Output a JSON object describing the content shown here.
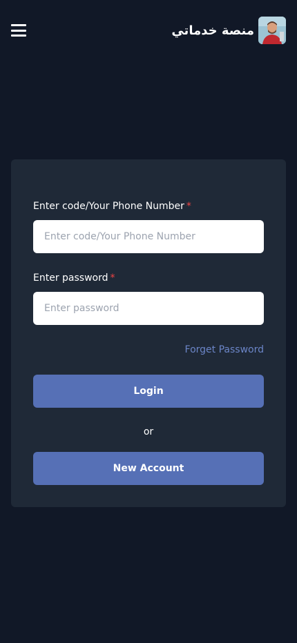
{
  "header": {
    "brand_name": "منصة خدماتي",
    "avatar_icon": "user-avatar-photo",
    "menu_icon": "hamburger-menu-icon"
  },
  "form": {
    "phone_label": "Enter code/Your Phone Number",
    "phone_placeholder": "Enter code/Your Phone Number",
    "phone_value": "",
    "password_label": "Enter password",
    "password_placeholder": "Enter password",
    "password_value": "",
    "required_mark": "*",
    "forget_password": "Forget Password",
    "login_label": "Login",
    "or_text": "or",
    "new_account_label": "New Account"
  },
  "colors": {
    "page_bg": "#111827",
    "card_bg": "#1f2937",
    "accent": "#5670b6",
    "link": "#6b85c7",
    "required": "#ef4444"
  }
}
